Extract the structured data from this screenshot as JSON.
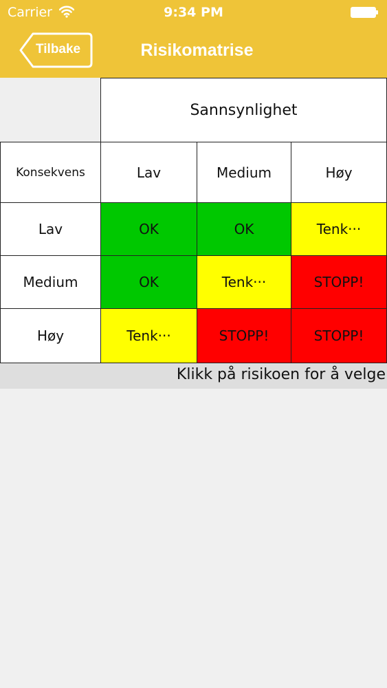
{
  "status_bar": {
    "carrier": "Carrier",
    "time": "9:34 PM",
    "wifi_icon": "wifi-icon",
    "battery_icon": "battery-icon"
  },
  "nav": {
    "back_label": "Tilbake",
    "title": "Risikomatrise"
  },
  "colors": {
    "bar": "#efc438",
    "ok": "#00c800",
    "tenk": "#ffff00",
    "stopp": "#ff0000"
  },
  "matrix": {
    "probability_header": "Sannsynlighet",
    "consequence_header": "Konsekvens",
    "columns": [
      "Lav",
      "Medium",
      "Høy"
    ],
    "rows": [
      {
        "label": "Lav",
        "cells": [
          "OK",
          "OK",
          "Tenk···"
        ]
      },
      {
        "label": "Medium",
        "cells": [
          "OK",
          "Tenk···",
          "STOPP!"
        ]
      },
      {
        "label": "Høy",
        "cells": [
          "Tenk···",
          "STOPP!",
          "STOPP!"
        ]
      }
    ]
  },
  "hint": "Klikk på risikoen for å velge"
}
